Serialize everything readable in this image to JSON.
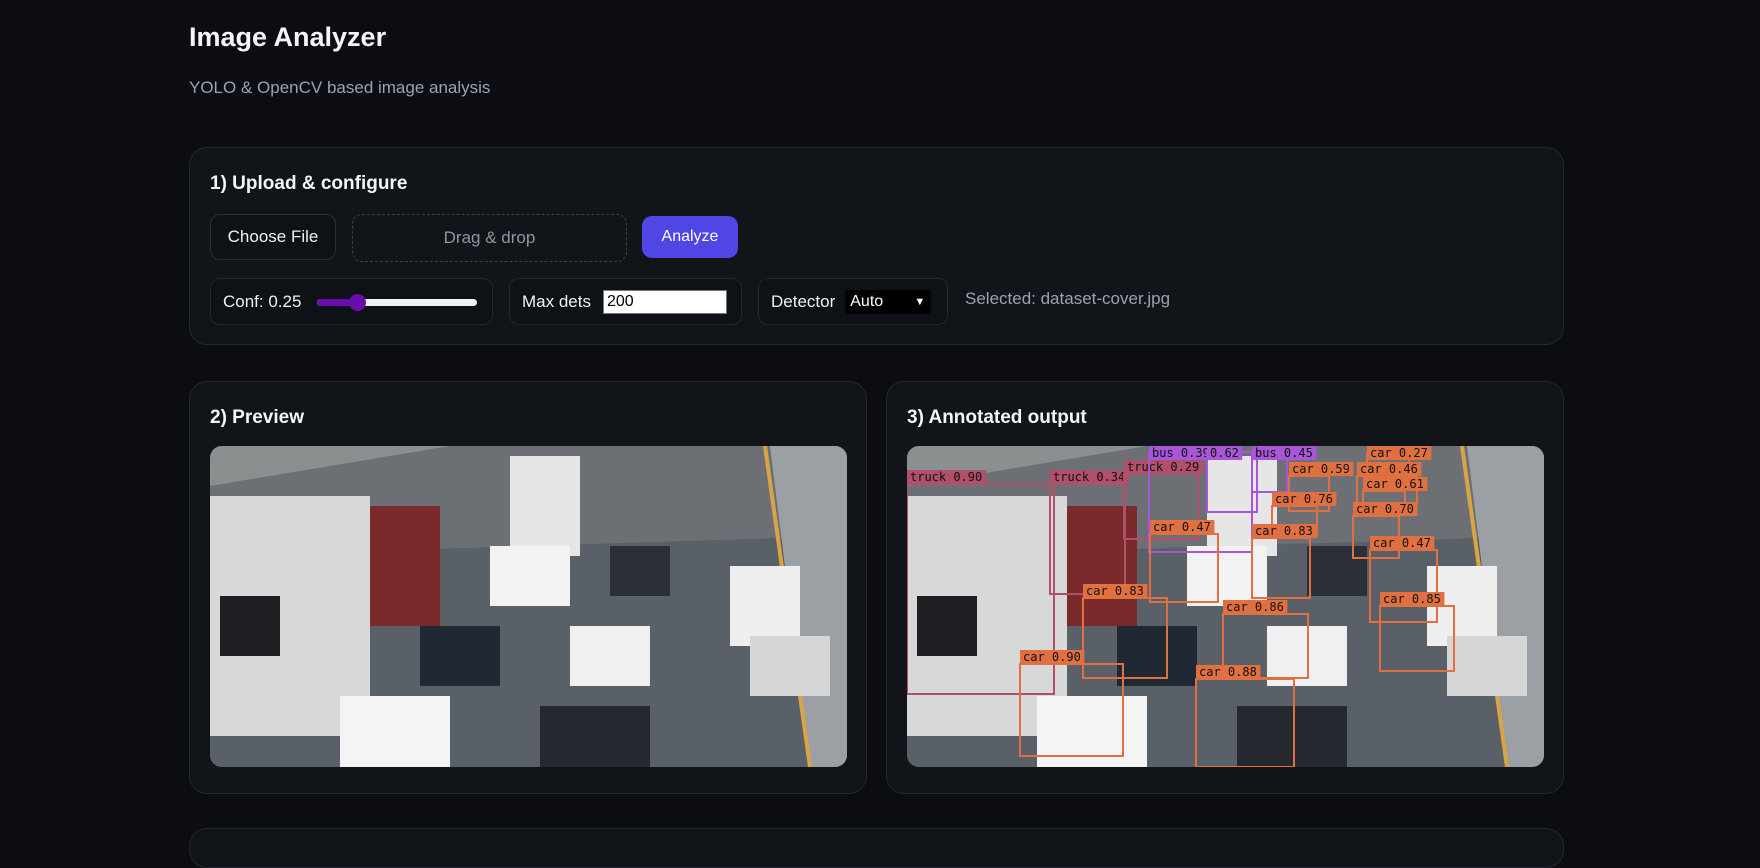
{
  "app": {
    "title": "Image Analyzer",
    "subtitle": "YOLO & OpenCV based image analysis"
  },
  "upload": {
    "heading": "1) Upload & configure",
    "choose_file_label": "Choose File",
    "dropzone_label": "Drag & drop",
    "analyze_label": "Analyze",
    "conf_label": "Conf: 0.25",
    "conf_value": 0.25,
    "max_dets_label": "Max dets",
    "max_dets_value": "200",
    "detector_label": "Detector",
    "detector_value": "Auto",
    "selected_text": "Selected: dataset-cover.jpg"
  },
  "preview": {
    "heading": "2) Preview"
  },
  "output": {
    "heading": "3) Annotated output",
    "detections": [
      {
        "label": "truck 0.90",
        "class": "truck"
      },
      {
        "label": "truck 0.34",
        "class": "truck"
      },
      {
        "label": "truck 0.29",
        "class": "truck"
      },
      {
        "label": "bus 0.39",
        "class": "bus"
      },
      {
        "label": "0.62",
        "class": "bus"
      },
      {
        "label": "bus 0.45",
        "class": "bus"
      },
      {
        "label": "car 0.59",
        "class": "car"
      },
      {
        "label": "car 0.27",
        "class": "car"
      },
      {
        "label": "car 0.46",
        "class": "car"
      },
      {
        "label": "car 0.61",
        "class": "car"
      },
      {
        "label": "car 0.76",
        "class": "car"
      },
      {
        "label": "car 0.70",
        "class": "car"
      },
      {
        "label": "car 0.47",
        "class": "car"
      },
      {
        "label": "car 0.83",
        "class": "car"
      },
      {
        "label": "car 0.47",
        "class": "car"
      },
      {
        "label": "car 0.83",
        "class": "car"
      },
      {
        "label": "car 0.86",
        "class": "car"
      },
      {
        "label": "car 0.85",
        "class": "car"
      },
      {
        "label": "car 0.90",
        "class": "car"
      },
      {
        "label": "car 0.88",
        "class": "car"
      }
    ]
  },
  "colors": {
    "accent": "#5046e5",
    "slider": "#6a0dad",
    "car_box": "#e07040",
    "truck_box": "#b0506a",
    "bus_box": "#a855d8"
  }
}
